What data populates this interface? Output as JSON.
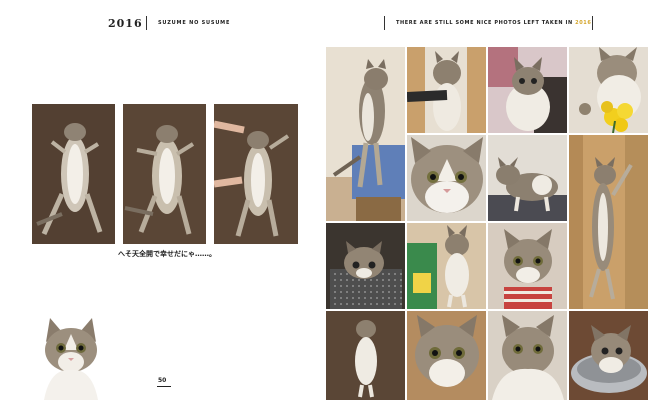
{
  "header": {
    "year": "2016",
    "series": "SUZUME NO SUSUME",
    "tagline_prefix": "THERE ARE STILL SOME NICE PHOTOS LEFT TAKEN IN ",
    "tagline_year": "2016",
    "tagline_suffix": "."
  },
  "caption": "へそ天全開で幸せだにゃ……。",
  "page_number": "50",
  "colors": {
    "text": "#222222",
    "accent": "#d4a52a",
    "carpet": "#5a4636",
    "floor": "#b28a5c"
  }
}
